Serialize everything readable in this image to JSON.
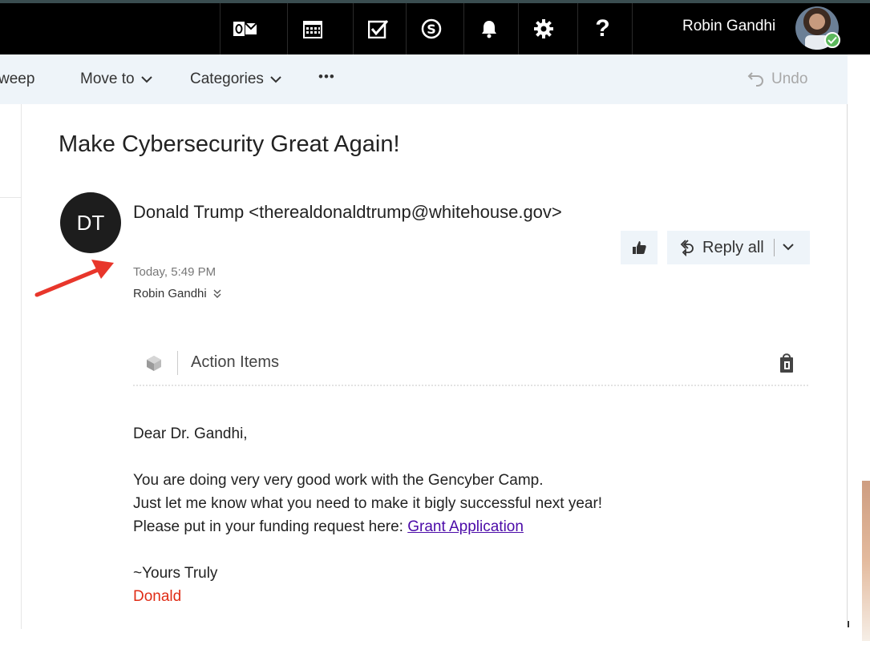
{
  "topbar": {
    "user_name": "Robin Gandhi",
    "icons": [
      "outlook-icon",
      "calendar-icon",
      "tasks-icon",
      "skype-icon",
      "bell-icon",
      "gear-icon",
      "help-icon"
    ],
    "help_label": "?",
    "background": "#000000"
  },
  "command_bar": {
    "sweep_label": "weep",
    "move_to_label": "Move to",
    "categories_label": "Categories",
    "more_label": "•••",
    "undo_label": "Undo",
    "background": "#eef4f9"
  },
  "message": {
    "subject": "Make Cybersecurity Great Again!",
    "sender_initials": "DT",
    "sender": "Donald Trump <therealdonaldtrump@whitehouse.gov>",
    "date": "Today, 5:49 PM",
    "recipient": "Robin Gandhi",
    "reply_all_label": "Reply all"
  },
  "action_items": {
    "label": "Action Items"
  },
  "body": {
    "greeting": "Dear Dr. Gandhi,",
    "line1": "You are doing very very good work with the Gencyber Camp.",
    "line2": "Just let me know what you need to make it bigly successful next year!",
    "line3_prefix": "Please put in your funding request here: ",
    "link_text": "Grant Application",
    "closing": "~Yours Truly",
    "signature": "Donald"
  },
  "colors": {
    "link": "#4b0aa8",
    "signature": "#e02c16",
    "annotation_arrow": "#e8362b",
    "presence": "#5cb85c"
  }
}
